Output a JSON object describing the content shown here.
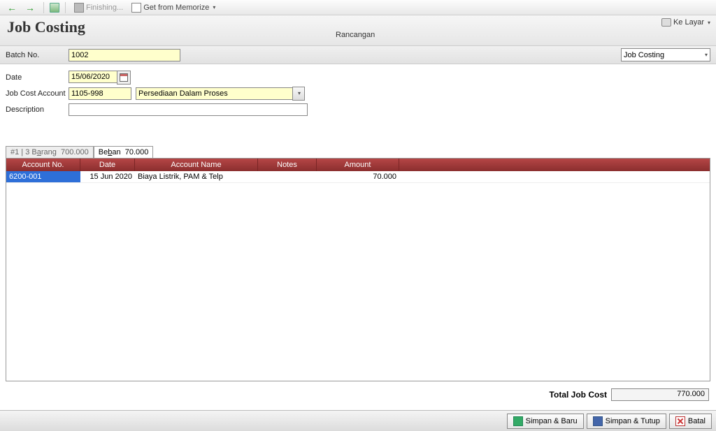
{
  "toolbar": {
    "finishing": "Finishing...",
    "memorize": "Get from Memorize"
  },
  "header": {
    "title": "Job Costing",
    "status": "Rancangan",
    "kelayar": "Ke Layar",
    "dropdown": "Job Costing"
  },
  "form": {
    "batch_label": "Batch No.",
    "batch_value": "1002",
    "date_label": "Date",
    "date_value": "15/06/2020",
    "acct_label": "Job Cost Account",
    "acct_code": "1105-998",
    "acct_name": "Persediaan Dalam Proses",
    "desc_label": "Description",
    "desc_value": ""
  },
  "tabs": {
    "tab1_pre": "#1 | 3 ",
    "tab1_label": "Barang",
    "tab1_amt": "700.000",
    "tab2_label": "Beban",
    "tab2_amt": "70.000"
  },
  "grid": {
    "h1": "Account No.",
    "h2": "Date",
    "h3": "Account Name",
    "h4": "Notes",
    "h5": "Amount",
    "rows": [
      {
        "acct": "6200-001",
        "date": "15 Jun 2020",
        "name": "Biaya Listrik, PAM & Telp",
        "notes": "",
        "amount": "70.000"
      }
    ]
  },
  "total": {
    "label": "Total Job Cost",
    "value": "770.000"
  },
  "footer": {
    "save_new": "Simpan & Baru",
    "save_close": "Simpan & Tutup",
    "cancel": "Batal"
  }
}
